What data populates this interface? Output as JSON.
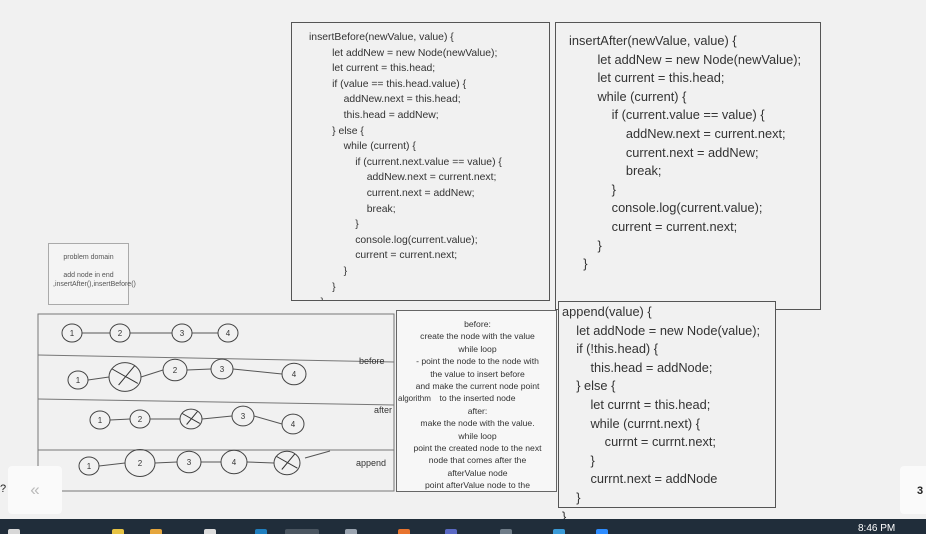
{
  "insert_before": {
    "lines": [
      "insertBefore(newValue, value) {",
      "        let addNew = new Node(newValue);",
      "        let current = this.head;",
      "        if (value == this.head.value) {",
      "            addNew.next = this.head;",
      "            this.head = addNew;",
      "        } else {",
      "            while (current) {",
      "                if (current.next.value == value) {",
      "                    addNew.next = current.next;",
      "                    current.next = addNew;",
      "                    break;",
      "                }",
      "                console.log(current.value);",
      "                current = current.next;",
      "            }",
      "        }",
      "    }"
    ]
  },
  "insert_after": {
    "lines": [
      "insertAfter(newValue, value) {",
      "        let addNew = new Node(newValue);",
      "        let current = this.head;",
      "        while (current) {",
      "            if (current.value == value) {",
      "                addNew.next = current.next;",
      "                current.next = addNew;",
      "                break;",
      "            }",
      "            console.log(current.value);",
      "            current = current.next;",
      "        }",
      "    }"
    ]
  },
  "append_code": {
    "lines": [
      "append(value) {",
      "    let addNode = new Node(value);",
      "    if (!this.head) {",
      "        this.head = addNode;",
      "    } else {",
      "        let currnt = this.head;",
      "        while (currnt.next) {",
      "            currnt = currnt.next;",
      "        }",
      "        currnt.next = addNode",
      "    }",
      "}"
    ]
  },
  "problem_domain": {
    "title": "problem domain",
    "body": "add node in end ,insertAfter(),insertBefore()"
  },
  "algorithm": {
    "lines": [
      "before:",
      "create the node with the value",
      "while loop",
      "- point the node to the node with",
      "the value to insert before",
      "and make the current node point",
      "to the inserted node",
      "after:",
      "make the node with the value.",
      "while loop",
      "point the created node to the next",
      "node that comes after the",
      "afterValue node",
      "point afterValue node to the"
    ],
    "side_label": "algorithm"
  },
  "rows": [
    {
      "label": "",
      "nodes": [
        "1",
        "2",
        "3",
        "4"
      ]
    },
    {
      "label": "before",
      "nodes": [
        "1",
        "",
        "2",
        "3",
        "4"
      ]
    },
    {
      "label": "after",
      "nodes": [
        "1",
        "2",
        "",
        "3",
        "4"
      ]
    },
    {
      "label": "append",
      "nodes": [
        "1",
        "2",
        "3",
        "4",
        ""
      ]
    }
  ],
  "nav": {
    "back_glyph": "«",
    "fwd_text": "3",
    "edge_text": "?"
  },
  "taskbar": {
    "clock": "8:46 PM"
  }
}
